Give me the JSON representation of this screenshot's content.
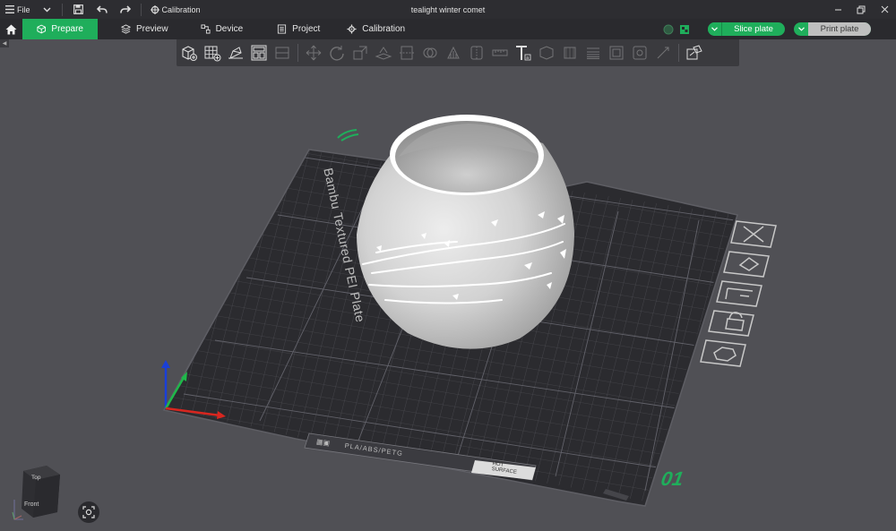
{
  "titlebar": {
    "file_label": "File",
    "calibration_label": "Calibration",
    "window_title": "tealight winter comet"
  },
  "tabs": [
    {
      "label": "Prepare",
      "active": true,
      "icon": "cube-outline-icon"
    },
    {
      "label": "Preview",
      "active": false,
      "icon": "layers-icon"
    },
    {
      "label": "Device",
      "active": false,
      "icon": "device-icon"
    },
    {
      "label": "Project",
      "active": false,
      "icon": "document-icon"
    },
    {
      "label": "Calibration",
      "active": false,
      "icon": "gear-icon"
    }
  ],
  "actions": {
    "slice_label": "Slice plate",
    "print_label": "Print plate"
  },
  "plate": {
    "plate_name": "Bambu Textured PEI Plate",
    "filament_types": "PLA/ABS/PETG",
    "surface_line1": "HOT",
    "surface_line2": "SURFACE",
    "plate_number": "01"
  },
  "navcube": {
    "top_label": "Top",
    "front_label": "Front"
  },
  "colors": {
    "accent": "#1fae5b",
    "background": "#505055",
    "titlebar": "#2d2d31",
    "plate": "#2c2c30"
  }
}
